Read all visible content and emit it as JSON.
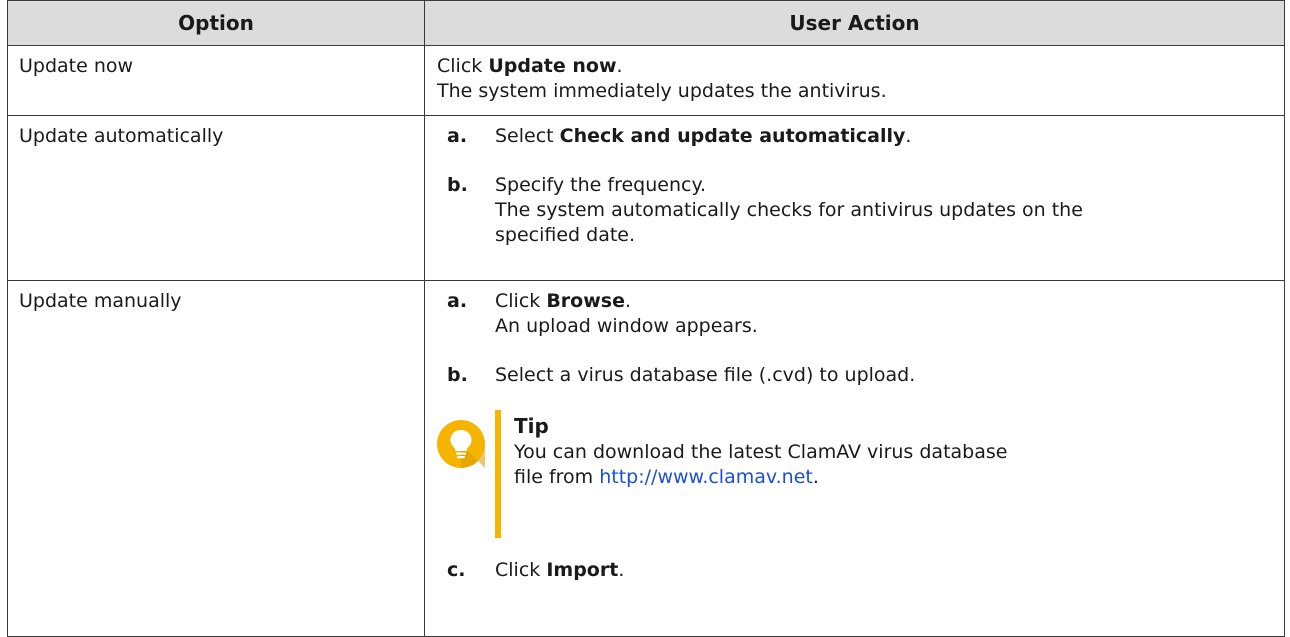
{
  "table": {
    "headers": [
      "Option",
      "User Action"
    ],
    "rows": [
      {
        "option": "Update now",
        "action_prefix": "Click ",
        "action_bold": "Update now",
        "action_suffix": ".",
        "action_line2": "The system immediately updates the antivirus."
      },
      {
        "option": "Update automatically",
        "step_a_label": "a.",
        "step_a_prefix": "Select ",
        "step_a_bold": "Check and update automatically",
        "step_a_suffix": ".",
        "step_b_label": "b.",
        "step_b_text": "Specify the frequency.",
        "step_b_line2": "The system automatically checks for antivirus updates on the",
        "step_b_line3": "specified date."
      },
      {
        "option": "Update manually",
        "step_a_label": "a.",
        "step_a_prefix": "Click ",
        "step_a_bold": "Browse",
        "step_a_suffix": ".",
        "step_a_line2": "An upload window appears.",
        "step_b_label": "b.",
        "step_b_text": "Select a virus database file (.cvd) to upload.",
        "tip_title": "Tip",
        "tip_line1": "You can download the latest ClamAV virus database",
        "tip_line2_prefix": "file from ",
        "tip_link": "http://www.clamav.net",
        "tip_line2_suffix": ".",
        "step_c_label": "c.",
        "step_c_prefix": "Click ",
        "step_c_bold": "Import",
        "step_c_suffix": "."
      }
    ]
  },
  "colors": {
    "header_bg": "#dcdcdc",
    "tip_accent": "#f4b400",
    "link": "#1a4fd6"
  },
  "icons": {
    "tip": "lightbulb-icon"
  }
}
